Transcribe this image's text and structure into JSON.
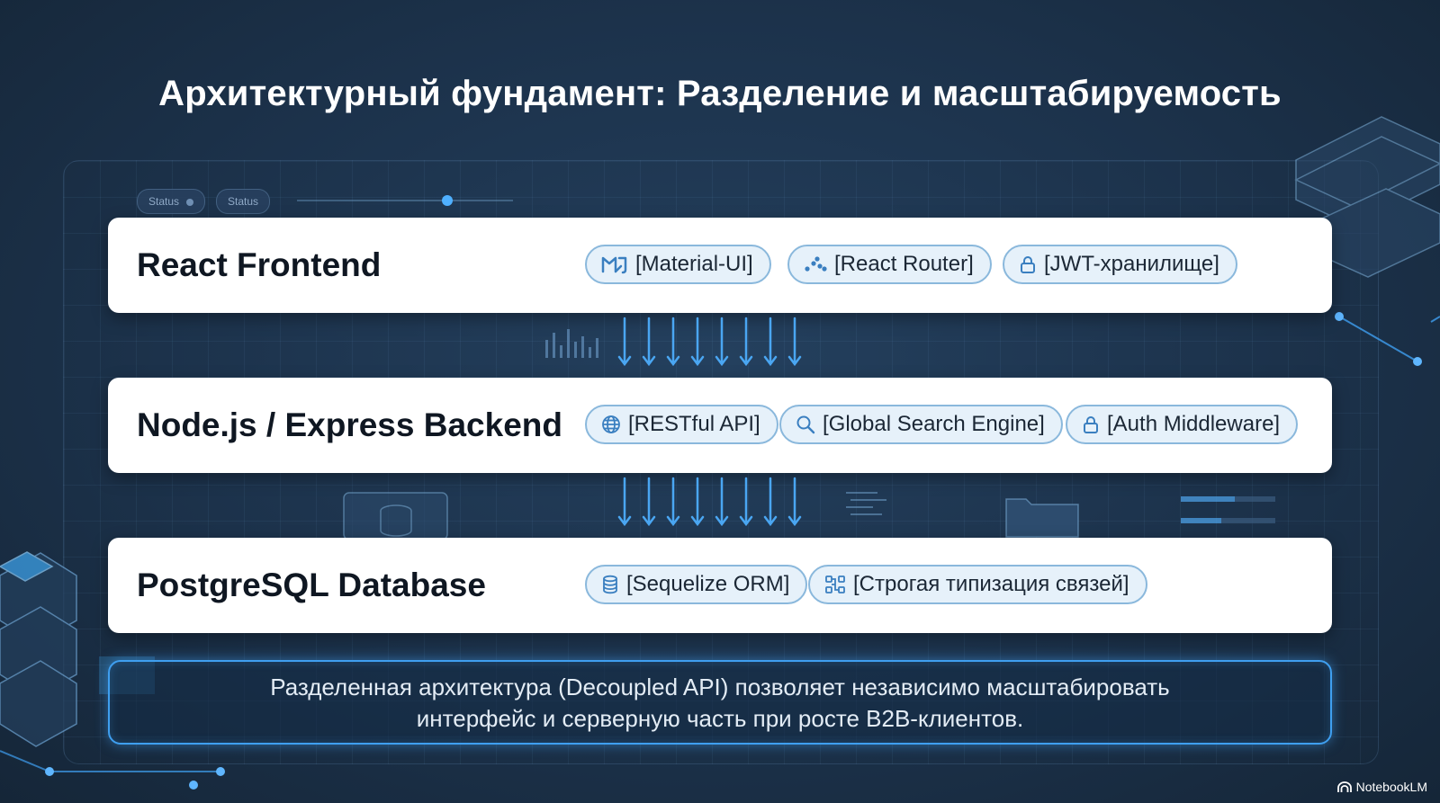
{
  "title": "Архитектурный фундамент: Разделение и масштабируемость",
  "background_status_labels": [
    "Status",
    "Status"
  ],
  "layers": [
    {
      "name": "React Frontend",
      "chips": [
        {
          "label": "[Material-UI]",
          "icon": "material-ui-icon"
        },
        {
          "label": "[React Router]",
          "icon": "router-icon"
        },
        {
          "label": "[JWT-хранилище]",
          "icon": "lock-icon"
        }
      ]
    },
    {
      "name": "Node.js / Express Backend",
      "chips": [
        {
          "label": "[RESTful API]",
          "icon": "globe-icon"
        },
        {
          "label": "[Global Search Engine]",
          "icon": "search-icon"
        },
        {
          "label": "[Auth Middleware]",
          "icon": "lock-icon"
        }
      ]
    },
    {
      "name": "PostgreSQL Database",
      "chips": [
        {
          "label": "[Sequelize ORM]",
          "icon": "database-icon"
        },
        {
          "label": "[Строгая типизация связей]",
          "icon": "relations-icon"
        }
      ]
    }
  ],
  "note": {
    "line1": "Разделенная архитектура (Decoupled API) позволяет независимо масштабировать",
    "line2": "интерфейс и серверную часть при росте B2B-клиентов."
  },
  "brand": "NotebookLM",
  "colors": {
    "background": "#1c324b",
    "accent": "#3f9ff0",
    "chip_fill": "#e6f1fa",
    "chip_border": "#8ab8dc",
    "card": "#ffffff"
  }
}
